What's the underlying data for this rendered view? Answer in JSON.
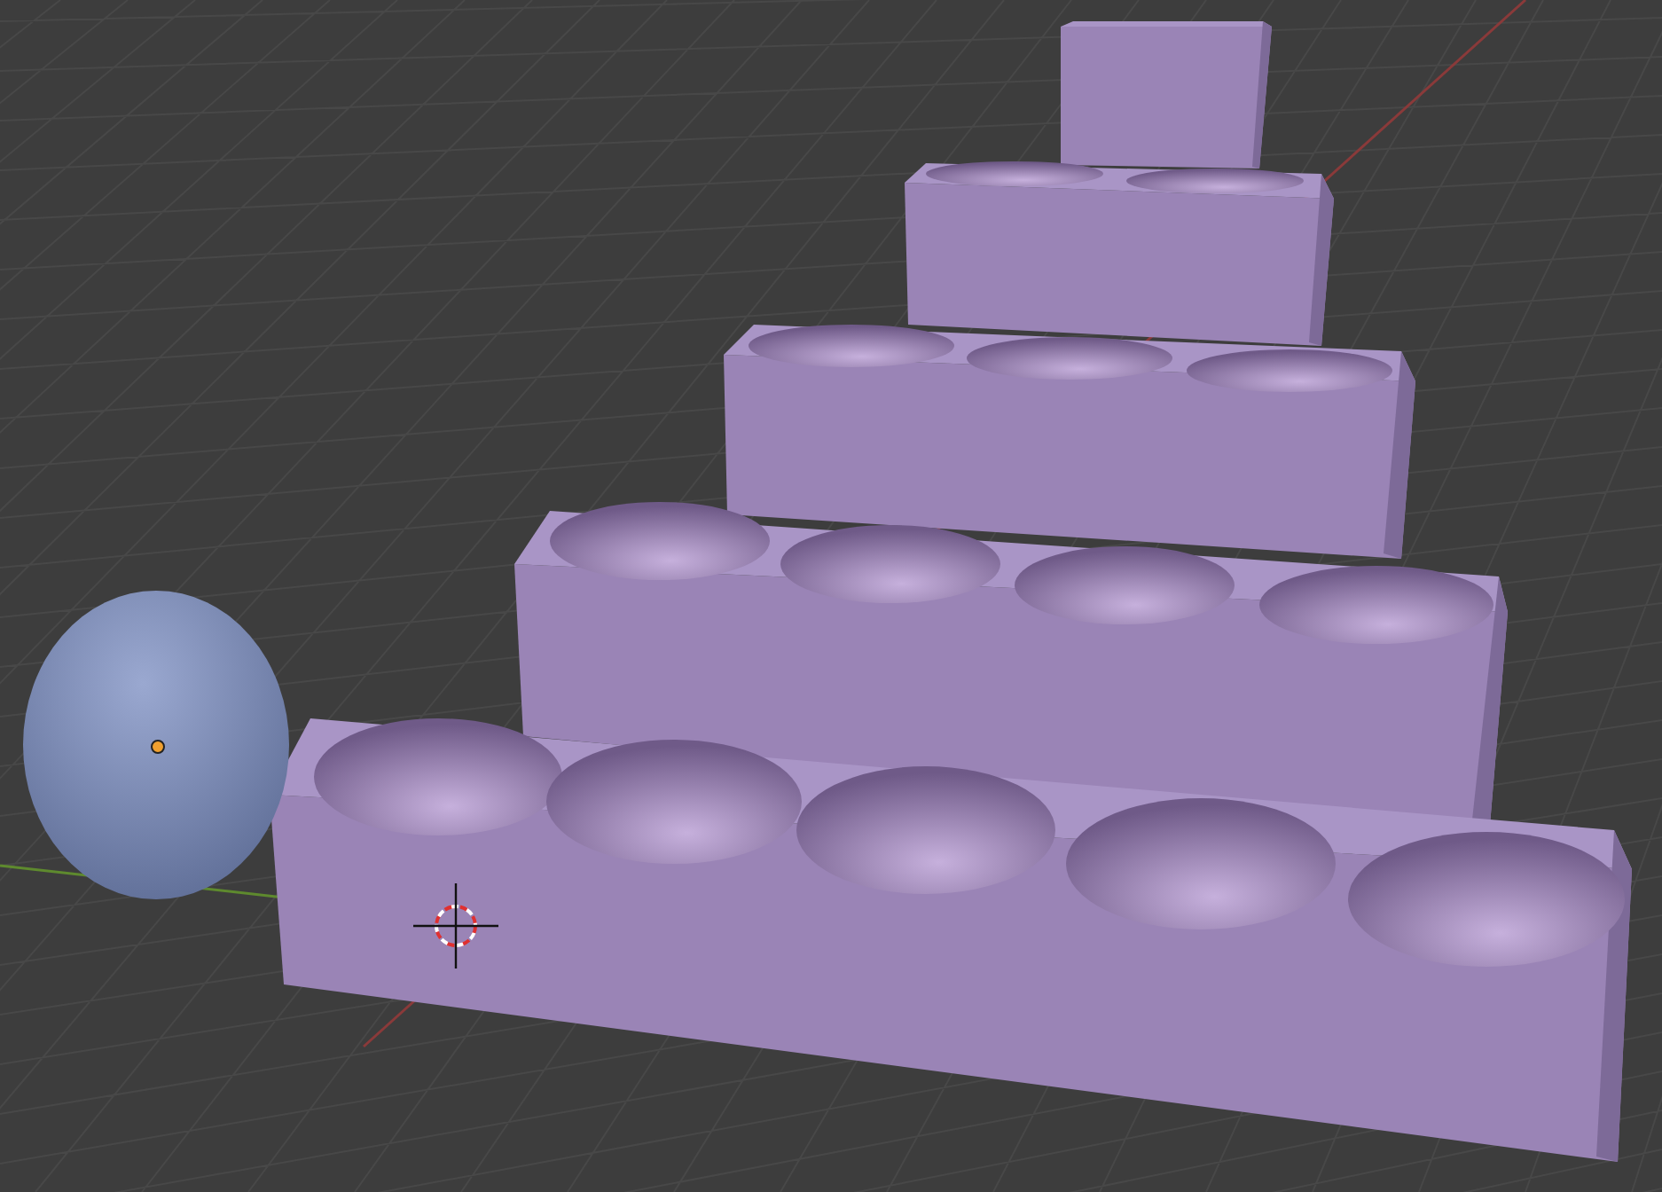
{
  "viewport": {
    "objects": [
      {
        "kind": "grid"
      },
      {
        "kind": "tray"
      },
      {
        "kind": "tray"
      },
      {
        "kind": "tray"
      },
      {
        "kind": "tray"
      },
      {
        "kind": "tray"
      },
      {
        "kind": "sphere"
      },
      {
        "kind": "cursor"
      }
    ]
  }
}
